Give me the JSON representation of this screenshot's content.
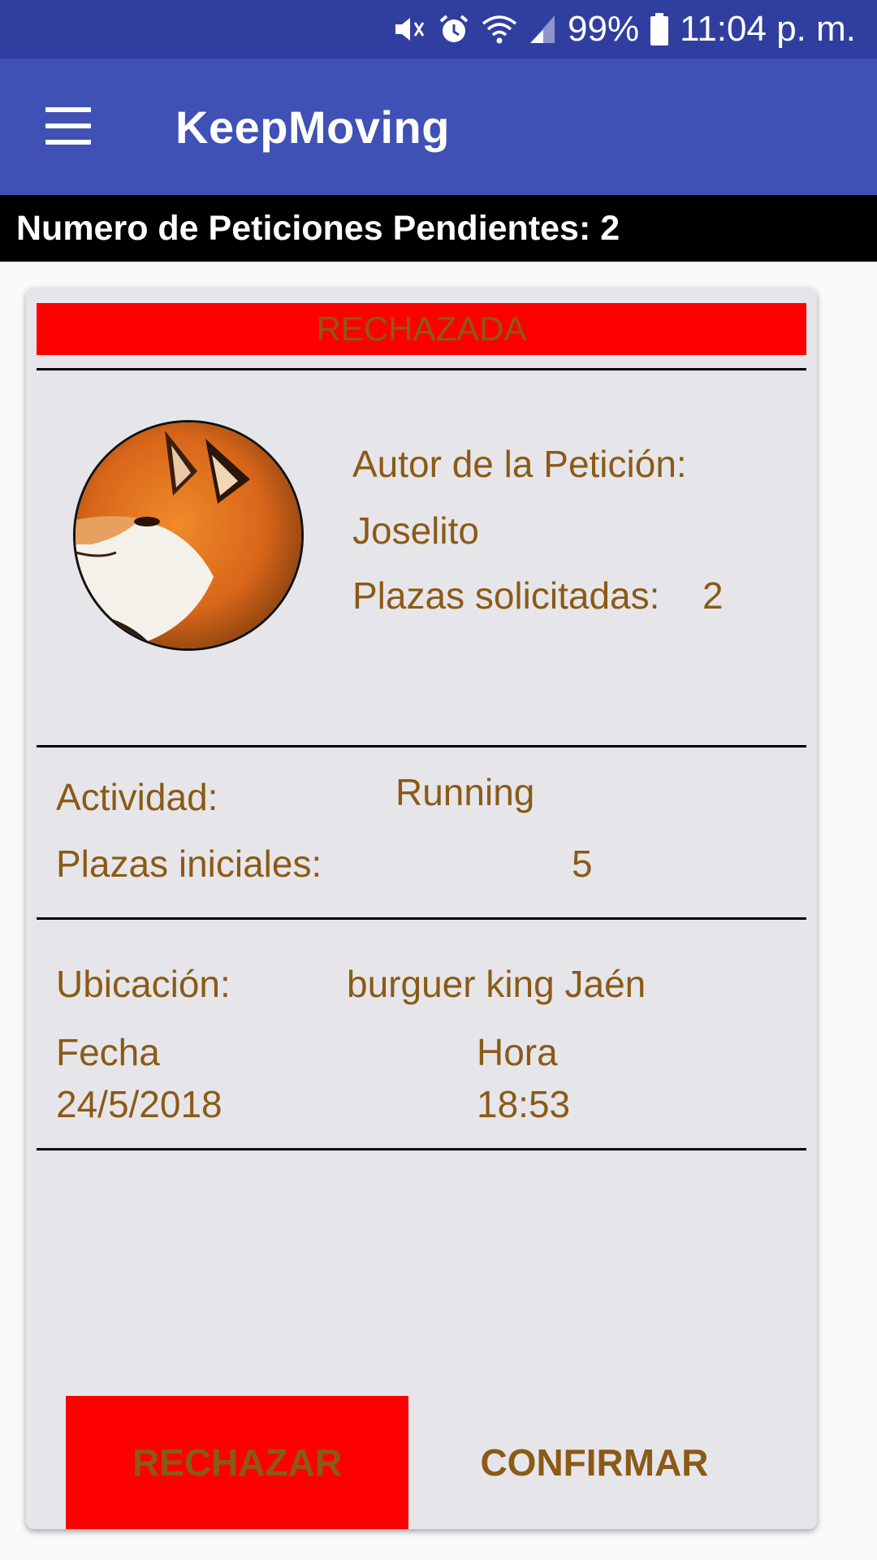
{
  "status_bar": {
    "battery": "99%",
    "time": "11:04 p. m.",
    "icons": [
      "mute-vibrate-icon",
      "alarm-icon",
      "wifi-icon",
      "signal-icon",
      "battery-icon"
    ]
  },
  "app_bar": {
    "title": "KeepMoving",
    "menu_icon": "hamburger-menu-icon"
  },
  "pending_bar": {
    "text": "Numero de Peticiones Pendientes: 2"
  },
  "card": {
    "status": "RECHAZADA",
    "avatar_icon": "fox-avatar-icon",
    "author_label": "Autor de la Petición:",
    "author_name": "Joselito",
    "requested_seats_label": "Plazas solicitadas:",
    "requested_seats_value": "2",
    "activity_label": "Actividad:",
    "activity_value": "Running",
    "initial_seats_label": "Plazas iniciales:",
    "initial_seats_value": "5",
    "location_label": "Ubicación:",
    "location_value": "burguer king Jaén",
    "date_label": "Fecha",
    "date_value": "24/5/2018",
    "time_label": "Hora",
    "time_value": "18:53",
    "reject_button": "RECHAZAR",
    "confirm_button": "CONFIRMAR"
  },
  "colors": {
    "status_bar": "#303f9f",
    "app_bar": "#3f51b5",
    "card_background": "#e6e6ea",
    "accent_red": "#ff0000",
    "text_brown": "#8b5a16"
  }
}
